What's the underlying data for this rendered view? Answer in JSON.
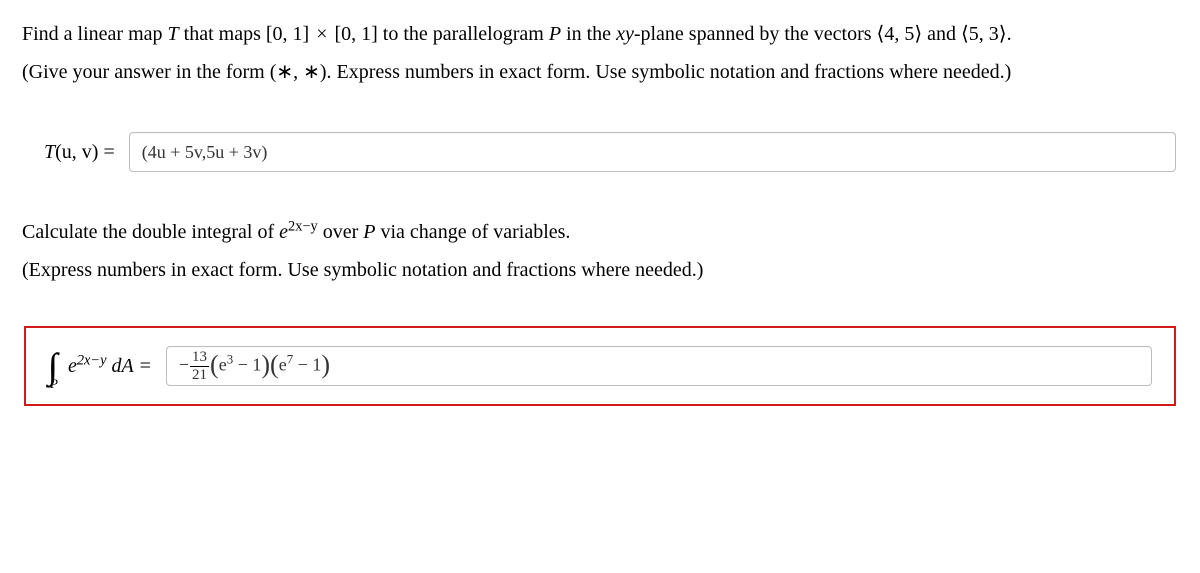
{
  "problem1": {
    "line1_pre": "Find a linear map ",
    "line1_T": "T",
    "line1_mid1": " that maps [0, 1] ",
    "line1_times": "×",
    "line1_mid2": " [0, 1] to the parallelogram ",
    "line1_P": "P",
    "line1_mid3": " in the ",
    "line1_xy": "xy",
    "line1_mid4": "-plane spanned by the vectors ⟨4, 5⟩ and ⟨5, 3⟩.",
    "hint": "(Give your answer in the form (∗, ∗). Express numbers in exact form. Use symbolic notation and fractions where needed.)"
  },
  "answer1": {
    "label_T": "T",
    "label_uv": "(u, v) =",
    "value": "(4u + 5v,5u + 3v)"
  },
  "problem2": {
    "line1_pre": "Calculate the double integral of ",
    "line1_exp_base": "e",
    "line1_exp_sup": "2x−y",
    "line1_mid": " over ",
    "line1_P": "P",
    "line1_post": " via change of variables.",
    "hint": "(Express numbers in exact form. Use symbolic notation and fractions where needed.)"
  },
  "answer2": {
    "iint_sub": "P",
    "integrand_base": "e",
    "integrand_sup": "2x−y",
    "dA": " dA =",
    "value_minus": "−",
    "frac_num": "13",
    "frac_den": "21",
    "paren1_open": "(",
    "e1_base": "e",
    "e1_sup": "3",
    "minus1": " − 1",
    "paren1_close": ")",
    "paren2_open": "(",
    "e2_base": "e",
    "e2_sup": "7",
    "minus2": " − 1",
    "paren2_close": ")"
  }
}
